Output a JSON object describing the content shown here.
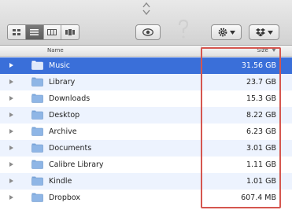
{
  "window": {
    "toolbar": {
      "view_buttons": [
        {
          "icon": "icon-view-icon",
          "active": false
        },
        {
          "icon": "list-view-icon",
          "active": true
        },
        {
          "icon": "column-view-icon",
          "active": false
        },
        {
          "icon": "cover-flow-icon",
          "active": false
        }
      ],
      "quicklook_icon": "eye-icon",
      "help_icon": "question-icon",
      "action_icon": "gear-icon",
      "share_icon": "dropbox-icon"
    },
    "columns": {
      "name": "Name",
      "size": "Size"
    },
    "rows": [
      {
        "name": "Music",
        "size": "31.56 GB",
        "selected": true
      },
      {
        "name": "Library",
        "size": "23.7 GB",
        "selected": false
      },
      {
        "name": "Downloads",
        "size": "15.3 GB",
        "selected": false
      },
      {
        "name": "Desktop",
        "size": "8.22 GB",
        "selected": false
      },
      {
        "name": "Archive",
        "size": "6.23 GB",
        "selected": false
      },
      {
        "name": "Documents",
        "size": "3.01 GB",
        "selected": false
      },
      {
        "name": "Calibre Library",
        "size": "1.11 GB",
        "selected": false
      },
      {
        "name": "Kindle",
        "size": "1.01 GB",
        "selected": false
      },
      {
        "name": "Dropbox",
        "size": "607.4 MB",
        "selected": false
      }
    ],
    "colors": {
      "selection": "#3a6fd9",
      "folder": "#8fb6e6",
      "highlight_box": "#d5564f",
      "alt_row": "#edf3fe"
    }
  }
}
